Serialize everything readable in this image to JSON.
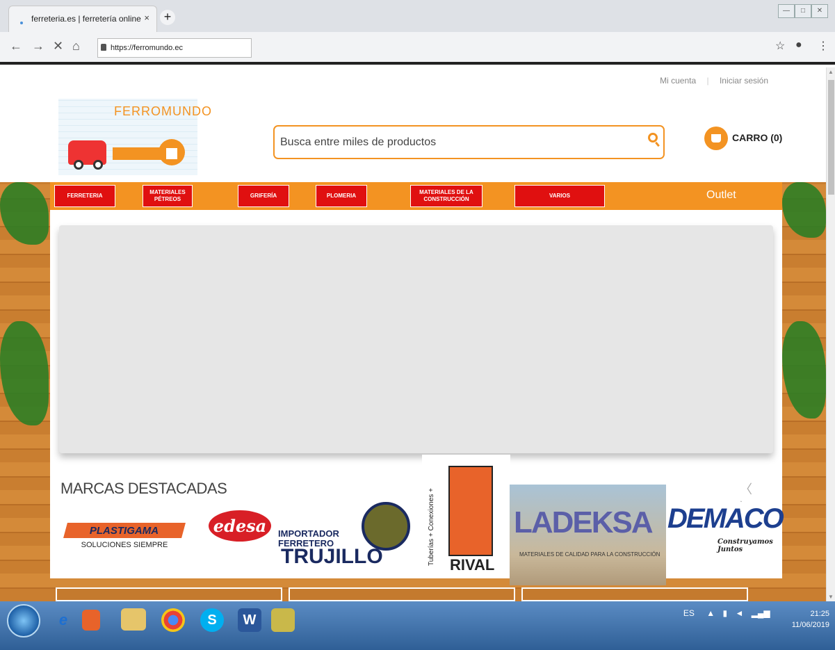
{
  "browser": {
    "tab_title": "ferreteria.es | ferretería online",
    "tab_close": "×",
    "new_tab": "+",
    "url": "https://ferromundo.ec",
    "nav": {
      "back": "←",
      "forward": "→",
      "stop": "✕",
      "home": "⌂"
    },
    "star": "☆",
    "profile": "●",
    "menu": "⋮"
  },
  "header": {
    "account": {
      "my_account": "Mi cuenta",
      "separator": "|",
      "login": "Iniciar sesión"
    },
    "logo_text": "FERROMUNDO",
    "search_placeholder": "Busca entre miles de productos",
    "cart_label": "CARRO (0)"
  },
  "menu": [
    {
      "label": "FERRETERIA"
    },
    {
      "label": "MATERIALES PÉTREOS"
    },
    {
      "label": "GRIFERÍA"
    },
    {
      "label": "PLOMERIA"
    },
    {
      "label": "MATERIALES DE LA CONSTRUCCIÓN"
    },
    {
      "label": "VARIOS"
    }
  ],
  "outlet": "Outlet",
  "brands": {
    "title": "MARCAS DESTACADAS",
    "prev": "〈",
    "next": "〉",
    "items": [
      {
        "name": "PLASTIGAMA",
        "tagline": "SOLUCIONES SIEMPRE"
      },
      {
        "name": "edesa"
      },
      {
        "line1": "IMPORTADOR",
        "line2": "FERRETERO",
        "name": "TRUJILLO"
      },
      {
        "name": "RIVAL",
        "vertical": "Tuberías + Conexiones +"
      },
      {
        "name": "LADEKSA",
        "tagline": "MATERIALES DE CALIDAD PARA LA CONSTRUCCIÓN"
      },
      {
        "name": "DEMACO",
        "tagline": "Construyamos Juntos"
      }
    ]
  },
  "taskbar": {
    "language": "ES",
    "time": "21:25",
    "date": "11/06/2019"
  },
  "colors": {
    "orange": "#f39322",
    "red": "#e01010"
  }
}
